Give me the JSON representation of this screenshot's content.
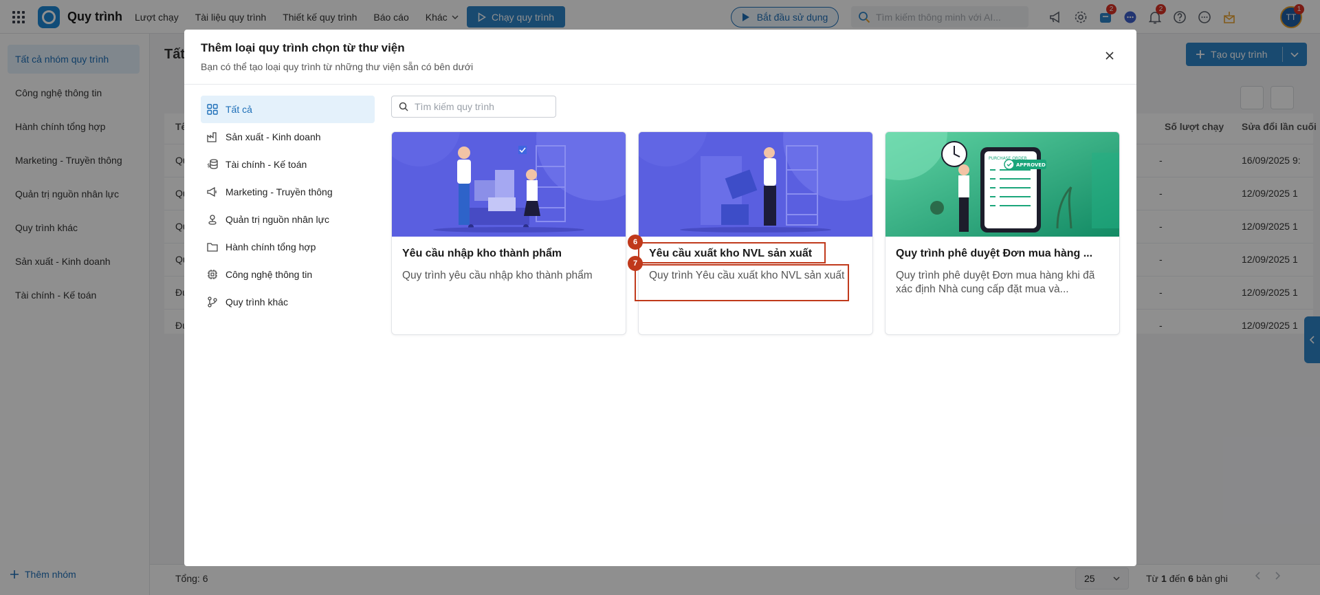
{
  "topbar": {
    "app_title": "Quy trình",
    "nav": [
      "Lượt chạy",
      "Tài liệu quy trình",
      "Thiết kế quy trình",
      "Báo cáo",
      "Khác"
    ],
    "run_button": "Chạy quy trình",
    "start_button": "Bắt đầu sử dụng",
    "ai_search_placeholder": "Tìm kiếm thông minh với AI...",
    "cart_badge": "2",
    "notif_badge": "2",
    "avatar_initials": "TT",
    "avatar_badge": "1"
  },
  "sidebar": {
    "items": [
      "Tất cả nhóm quy trình",
      "Công nghệ thông tin",
      "Hành chính tổng hợp",
      "Marketing - Truyền thông",
      "Quản trị nguồn nhân lực",
      "Quy trình khác",
      "Sản xuất - Kinh doanh",
      "Tài chính - Kế toán"
    ],
    "add_group": "Thêm nhóm"
  },
  "background": {
    "page_title": "Tất",
    "create_button": "Tạo quy trình",
    "col_name": "Tê",
    "col_runs": "Số lượt chạy",
    "col_modified": "Sửa đổi lần cuối",
    "rows": [
      {
        "name": "Qu",
        "runs": "-",
        "modified": "16/09/2025 9:"
      },
      {
        "name": "Qu",
        "runs": "-",
        "modified": "12/09/2025 1"
      },
      {
        "name": "Qu",
        "runs": "-",
        "modified": "12/09/2025 1"
      },
      {
        "name": "Qu",
        "runs": "-",
        "modified": "12/09/2025 1"
      },
      {
        "name": "Đu",
        "runs": "-",
        "modified": "12/09/2025 1"
      },
      {
        "name": "Đu",
        "runs": "-",
        "modified": "12/09/2025 1"
      }
    ],
    "total_label": "Tổng:",
    "total_value": "6",
    "page_size": "25",
    "range_from_label": "Từ",
    "range_from": "1",
    "range_to_label": "đến",
    "range_to": "6",
    "range_suffix": "bản ghi"
  },
  "modal": {
    "title": "Thêm loại quy trình chọn từ thư viện",
    "subtitle": "Bạn có thể tạo loại quy trình từ những thư viện sẵn có bên dưới",
    "categories": [
      "Tất cả",
      "Sản xuất - Kinh doanh",
      "Tài chính - Kế toán",
      "Marketing - Truyền thông",
      "Quản trị nguồn nhân lực",
      "Hành chính tổng hợp",
      "Công nghệ thông tin",
      "Quy trình khác"
    ],
    "search_placeholder": "Tìm kiếm quy trình",
    "cards": [
      {
        "title": "Yêu cầu nhập kho thành phẩm",
        "desc": "Quy trình yêu cầu nhập kho thành phẩm"
      },
      {
        "title": "Yêu cầu xuất kho NVL sản xuất",
        "desc": "Quy trình Yêu cầu xuất kho NVL sản xuất"
      },
      {
        "title": "Quy trình phê duyệt Đơn mua hàng ...",
        "desc": "Quy trình phê duyệt Đơn mua hàng khi đã xác định Nhà cung cấp đặt mua và..."
      }
    ],
    "image_labels": {
      "purchase_order": "PURCHASE ORDER",
      "approved": "APPROVED"
    },
    "markers": [
      "6",
      "7"
    ]
  },
  "colors": {
    "accent": "#2e84c8",
    "highlight": "#c0391b",
    "card_blue": "#5b5fe0",
    "card_green": "#1aa57a"
  }
}
